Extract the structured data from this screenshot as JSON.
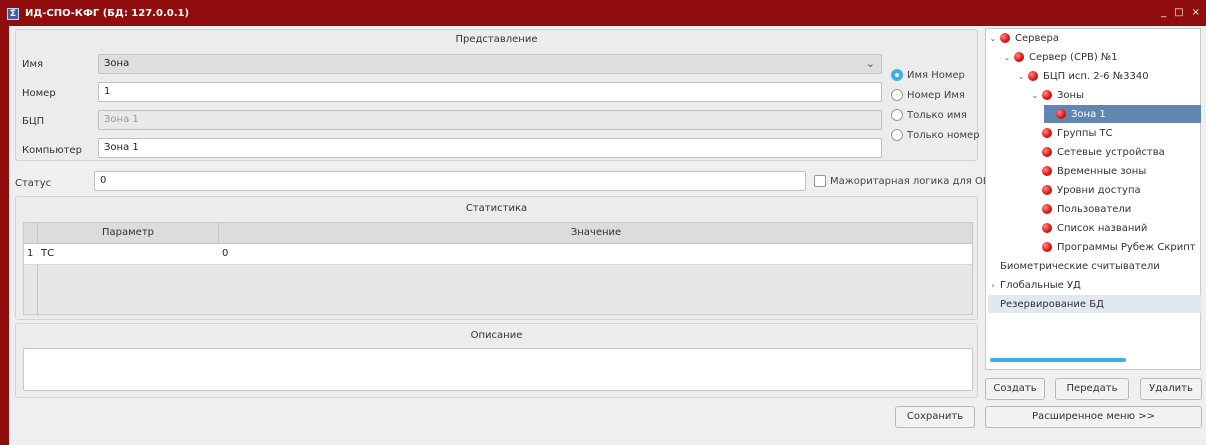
{
  "window": {
    "title": "ИД-СПО-КФГ (БД: 127.0.0.1)",
    "controls": [
      "_",
      "□",
      "×"
    ]
  },
  "representation": {
    "title": "Представление",
    "name_label": "Имя",
    "name_value": "Зона",
    "number_label": "Номер",
    "number_value": "1",
    "bcp_label": "БЦП",
    "bcp_value": "Зона 1",
    "computer_label": "Компьютер",
    "computer_value": "Зона 1",
    "radios": [
      "Имя Номер",
      "Номер Имя",
      "Только имя",
      "Только номер"
    ],
    "radio_selected": "Имя Номер"
  },
  "status": {
    "label": "Статус",
    "value": "0",
    "majority_label": "Мажоритарная логика для ОШС"
  },
  "statistics": {
    "title": "Статистика",
    "columns": [
      "Параметр",
      "Значение"
    ],
    "rows": [
      {
        "index": "1",
        "param": "ТС",
        "value": "0"
      }
    ]
  },
  "description": {
    "title": "Описание",
    "value": ""
  },
  "buttons": {
    "save": "Сохранить",
    "create": "Создать",
    "transfer": "Передать",
    "delete": "Удалить",
    "advanced_menu": "Расширенное меню >>"
  },
  "tree": [
    {
      "label": "Сервера",
      "depth": 0,
      "expander": "⌄",
      "ball": true
    },
    {
      "label": "Сервер (СРВ) №1",
      "depth": 1,
      "expander": "⌄",
      "ball": true
    },
    {
      "label": "БЦП исп. 2-6 №3340",
      "depth": 2,
      "expander": "⌄",
      "ball": true
    },
    {
      "label": "Зоны",
      "depth": 3,
      "expander": "⌄",
      "ball": true
    },
    {
      "label": "Зона 1",
      "depth": 4,
      "expander": "",
      "ball": true,
      "selected": true
    },
    {
      "label": "Группы ТС",
      "depth": 3,
      "expander": "",
      "ball": true
    },
    {
      "label": "Сетевые устройства",
      "depth": 3,
      "expander": "",
      "ball": true
    },
    {
      "label": "Временные зоны",
      "depth": 3,
      "expander": "",
      "ball": true
    },
    {
      "label": "Уровни доступа",
      "depth": 3,
      "expander": "",
      "ball": true
    },
    {
      "label": "Пользователи",
      "depth": 3,
      "expander": "",
      "ball": true
    },
    {
      "label": "Список названий",
      "depth": 3,
      "expander": "",
      "ball": true
    },
    {
      "label": "Программы Рубеж Скрипт",
      "depth": 3,
      "expander": "",
      "ball": true
    },
    {
      "label": "Биометрические считыватели",
      "depth": 0,
      "expander": "",
      "ball": false
    },
    {
      "label": "Глобальные УД",
      "depth": 0,
      "expander": "›",
      "ball": false
    },
    {
      "label": "Резервирование БД",
      "depth": 0,
      "expander": "",
      "ball": false,
      "highlight": true
    }
  ],
  "colors": {
    "titlebar": "#8f0d0d",
    "accent": "#3daee9",
    "selection": "#5f87b0",
    "node_ball": "#e01818"
  }
}
